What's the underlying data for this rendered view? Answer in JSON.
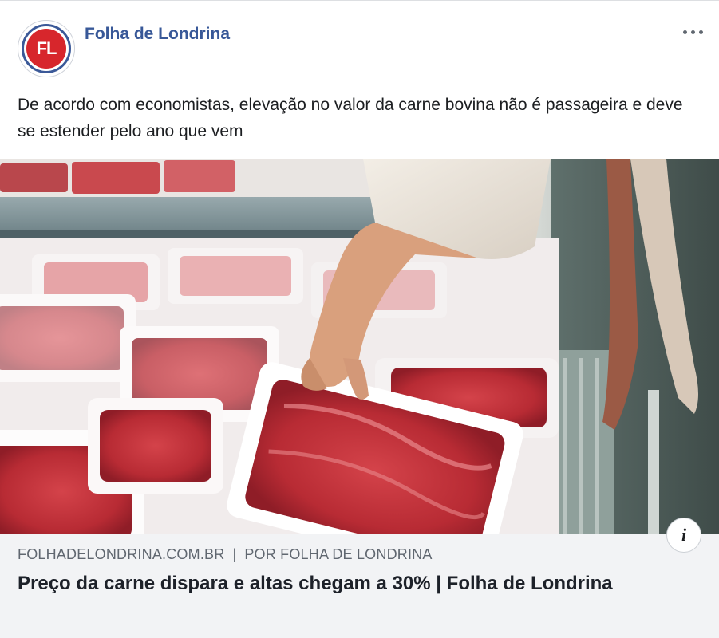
{
  "post": {
    "page_name": "Folha de Londrina",
    "avatar_text": "FL",
    "text": "De acordo com economistas, elevação no valor da carne bovina não é passageira e deve se estender pelo ano que vem",
    "more_icon": "more-horizontal-icon",
    "photo_alt": "Carne bovina embalada em bandejas no supermercado"
  },
  "link": {
    "domain": "FOLHADELONDRINA.COM.BR",
    "separator": "|",
    "byline": "POR FOLHA DE LONDRINA",
    "title": "Preço da carne dispara e altas chegam a 30% | Folha de Londrina",
    "info_icon": "info-icon",
    "info_glyph": "i"
  },
  "colors": {
    "page_name": "#385898",
    "brand_red": "#d7262c",
    "footer_bg": "#f2f3f5",
    "meta_text": "#606770"
  }
}
